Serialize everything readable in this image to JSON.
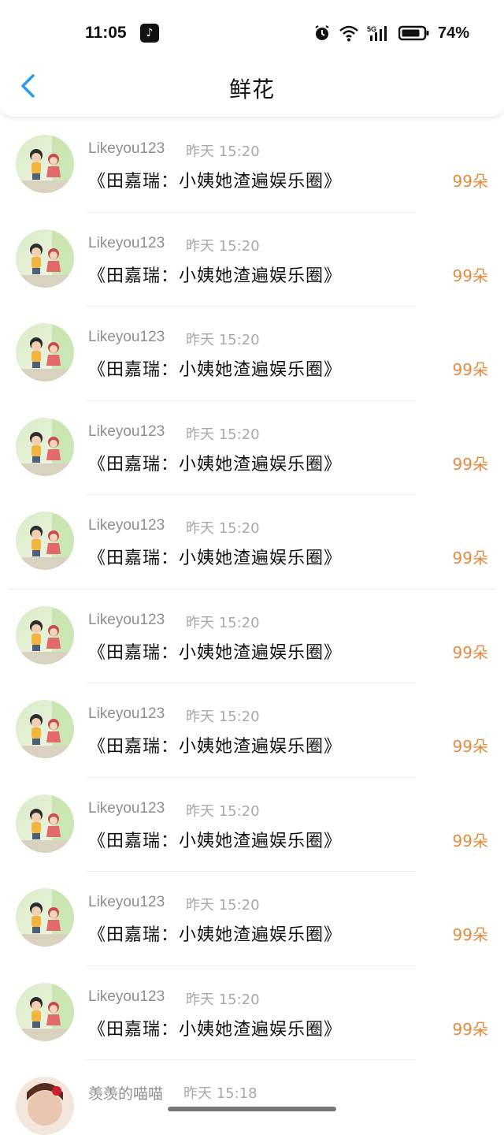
{
  "status_bar": {
    "time": "11:05",
    "app_icon": "tiktok-icon",
    "icons": [
      "alarm-icon",
      "wifi-icon",
      "5g-signal-icon",
      "battery-icon"
    ],
    "battery_percent": "74%"
  },
  "header": {
    "back_icon": "chevron-left-icon",
    "title": "鲜花"
  },
  "colors": {
    "accent_blue": "#2b9bf0",
    "flower_orange": "#e58b3e",
    "muted_text": "#8e8e8e"
  },
  "list": [
    {
      "user": "Likeyou123",
      "time": "昨天 15:20",
      "book": "《田嘉瑞：小姨她渣遍娱乐圈》",
      "flowers": "99朵"
    },
    {
      "user": "Likeyou123",
      "time": "昨天 15:20",
      "book": "《田嘉瑞：小姨她渣遍娱乐圈》",
      "flowers": "99朵"
    },
    {
      "user": "Likeyou123",
      "time": "昨天 15:20",
      "book": "《田嘉瑞：小姨她渣遍娱乐圈》",
      "flowers": "99朵"
    },
    {
      "user": "Likeyou123",
      "time": "昨天 15:20",
      "book": "《田嘉瑞：小姨她渣遍娱乐圈》",
      "flowers": "99朵"
    },
    {
      "user": "Likeyou123",
      "time": "昨天 15:20",
      "book": "《田嘉瑞：小姨她渣遍娱乐圈》",
      "flowers": "99朵"
    },
    {
      "user": "Likeyou123",
      "time": "昨天 15:20",
      "book": "《田嘉瑞：小姨她渣遍娱乐圈》",
      "flowers": "99朵"
    },
    {
      "user": "Likeyou123",
      "time": "昨天 15:20",
      "book": "《田嘉瑞：小姨她渣遍娱乐圈》",
      "flowers": "99朵"
    },
    {
      "user": "Likeyou123",
      "time": "昨天 15:20",
      "book": "《田嘉瑞：小姨她渣遍娱乐圈》",
      "flowers": "99朵"
    },
    {
      "user": "Likeyou123",
      "time": "昨天 15:20",
      "book": "《田嘉瑞：小姨她渣遍娱乐圈》",
      "flowers": "99朵"
    },
    {
      "user": "Likeyou123",
      "time": "昨天 15:20",
      "book": "《田嘉瑞：小姨她渣遍娱乐圈》",
      "flowers": "99朵"
    }
  ],
  "partial_row": {
    "user": "羡羡的喵喵",
    "time": "昨天 15:18"
  }
}
